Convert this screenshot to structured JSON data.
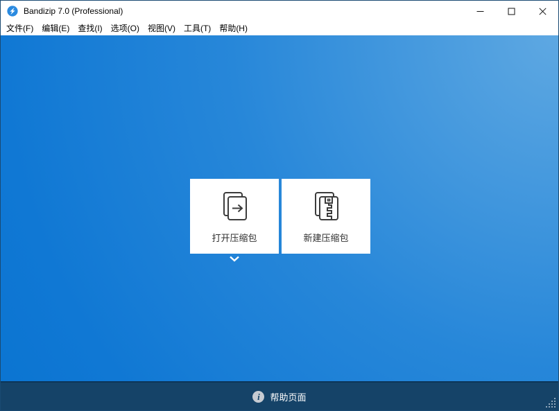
{
  "window": {
    "title": "Bandizip 7.0 (Professional)",
    "app_icon": "bandizip-logo-icon",
    "controls": [
      "minimize-icon",
      "maximize-icon",
      "close-icon"
    ]
  },
  "menu": {
    "items": [
      {
        "label": "文件(F)"
      },
      {
        "label": "编辑(E)"
      },
      {
        "label": "查找(I)"
      },
      {
        "label": "选项(O)"
      },
      {
        "label": "视图(V)"
      },
      {
        "label": "工具(T)"
      },
      {
        "label": "帮助(H)"
      }
    ]
  },
  "main": {
    "cards": [
      {
        "id": "open-archive",
        "label": "打开压缩包",
        "icon": "open-archive-icon"
      },
      {
        "id": "new-archive",
        "label": "新建压缩包",
        "icon": "new-archive-icon"
      }
    ],
    "expander": {
      "icon": "chevron-down-icon"
    }
  },
  "statusbar": {
    "info_icon": "info-icon",
    "help_label": "帮助页面",
    "grip_icon": "resize-grip-icon"
  },
  "colors": {
    "title-bg": "#ffffff",
    "menu-text": "#000000",
    "grad-light": "#5ea8e2",
    "grad-mid": "#2787d9",
    "grad-dark": "#0a74d1",
    "status-bg": "#154368",
    "separator": "#0c3558",
    "card-bg": "#ffffff",
    "card-text": "#303030",
    "icon-stroke": "#3c3c3c",
    "logo-blue": "#2a8ae0",
    "grip-dot": "#8fa6ba",
    "border": "#1a4a72"
  }
}
